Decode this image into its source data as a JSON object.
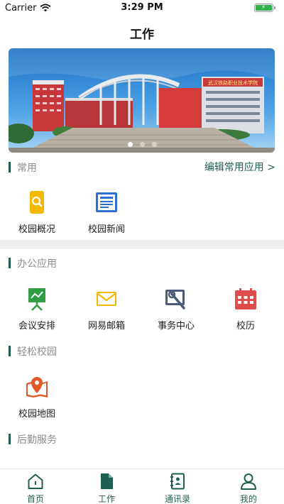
{
  "status_bar": {
    "carrier": "Carrier",
    "time": "3:29 PM"
  },
  "nav": {
    "title": "工作"
  },
  "banner": {
    "sign_text": "武汉铁路职业技术学院",
    "pages": 3,
    "active_page": 1
  },
  "sections": {
    "common": {
      "title": "常用",
      "edit_label": "编辑常用应用 >",
      "apps": [
        {
          "label": "校园概况",
          "icon": "search-doc-icon"
        },
        {
          "label": "校园新闻",
          "icon": "news-icon"
        }
      ]
    },
    "office": {
      "title": "办公应用",
      "apps": [
        {
          "label": "会议安排",
          "icon": "presentation-icon"
        },
        {
          "label": "网易邮箱",
          "icon": "mail-icon"
        },
        {
          "label": "事务中心",
          "icon": "tools-icon"
        },
        {
          "label": "校历",
          "icon": "calendar-icon"
        }
      ]
    },
    "campus": {
      "title": "轻松校园",
      "apps": [
        {
          "label": "校园地图",
          "icon": "map-pin-icon"
        }
      ]
    },
    "logistics": {
      "title": "后勤服务"
    }
  },
  "tabs": [
    {
      "label": "首页",
      "icon": "home-icon"
    },
    {
      "label": "工作",
      "icon": "document-icon"
    },
    {
      "label": "通讯录",
      "icon": "contacts-icon"
    },
    {
      "label": "我的",
      "icon": "user-icon"
    }
  ],
  "colors": {
    "accent": "#1f5f52",
    "section_text": "#8c8c8c",
    "battery": "#2fb24a",
    "icon_yellow": "#f5b800",
    "icon_blue": "#2e6fd0",
    "icon_green": "#2f9e44",
    "icon_slate": "#4b5a7a",
    "icon_red": "#e04b4b",
    "icon_orange": "#e05a2b"
  }
}
